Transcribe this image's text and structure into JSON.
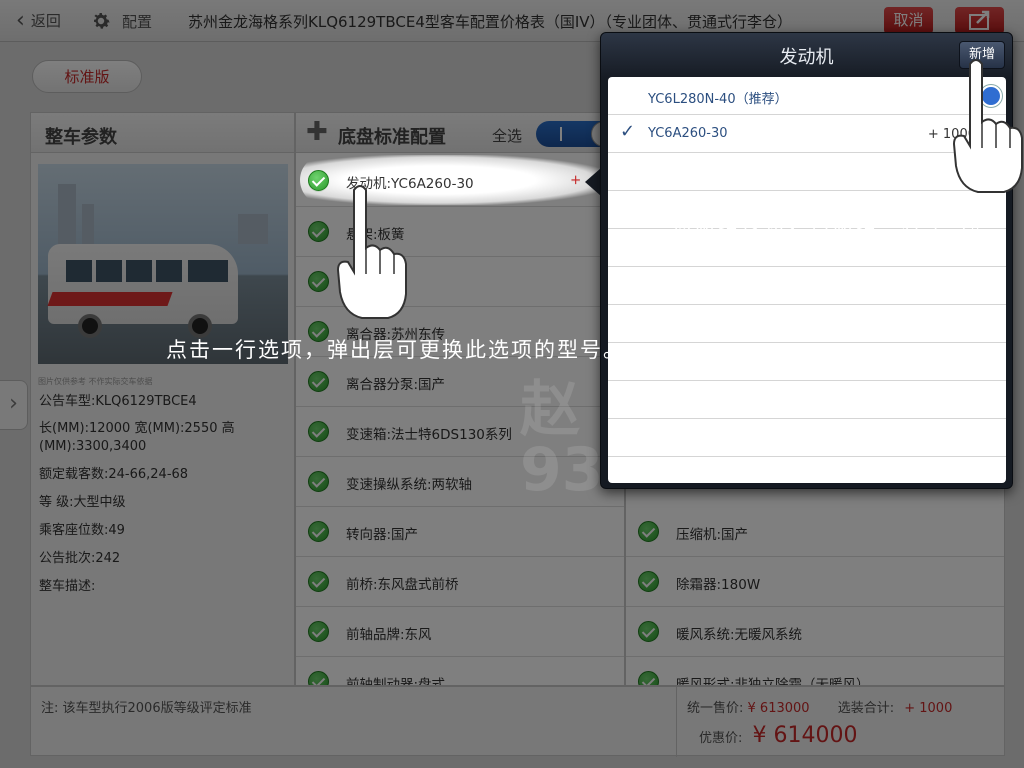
{
  "topbar": {
    "back_label": "返回",
    "config_label": "配置",
    "title": "苏州金龙海格系列KLQ6129TBCE4型客车配置价格表（国IV）（专业团体、贯通式行李仓）",
    "cancel_label": "取消"
  },
  "version_tab": "标准版",
  "left_panel": {
    "header": "整车参数",
    "photo_caption": "图片仅供参考 不作实际交车依据",
    "specs": [
      "公告车型:KLQ6129TBCE4",
      "长(MM):12000  宽(MM):2550  高(MM):3300,3400",
      "额定载客数:24-66,24-68",
      "等 级:大型中级",
      "乘客座位数:49",
      "公告批次:242",
      "整车描述:"
    ]
  },
  "middle_panel": {
    "header": "底盘标准配置",
    "select_all": "全选",
    "select_all_toggle": "I",
    "rows": [
      "发动机:YC6A260-30",
      "悬架:板簧",
      "",
      "离合器:苏州东传",
      "离合器分泵:国产",
      "变速箱:法士特6DS130系列",
      "变速操纵系统:两软轴",
      "转向器:国产",
      "前桥:东风盘式前桥",
      "前轴品牌:东风",
      "前轴制动器:盘式"
    ],
    "row0_price_sign": "+"
  },
  "right_panel": {
    "rows": [
      "压缩机:国产",
      "除霜器:180W",
      "暖风系统:无暖风系统",
      "暖风形式:非独立除霜（无暖风）"
    ]
  },
  "footer": {
    "note": "注:  该车型执行2006版等级评定标准",
    "unified_price_label": "统一售价:",
    "unified_price": "¥ 613000",
    "option_total_label": "选装合计:",
    "option_total": "+ 1000",
    "discount_label": "优惠价:",
    "discount_price": "¥ 614000"
  },
  "popover": {
    "title": "发动机",
    "add_label": "新增",
    "items": [
      {
        "name": "YC6L280N-40（推荐）",
        "price": "",
        "checked": false
      },
      {
        "name": "YC6A260-30",
        "price": "+ 1000",
        "checked": true
      }
    ],
    "check_mark": "✓"
  },
  "watermark": "赵\n93",
  "annotations": {
    "row_hint": "点击一行选项，弹出层可更换此选项的型号。",
    "add_hint": "点新增按钮，可新增一种型号。"
  },
  "colors": {
    "accent_red": "#c62828",
    "toggle_blue": "#2a6fc9",
    "check_green": "#2b9a2b",
    "popover_dark": "#151a22"
  }
}
